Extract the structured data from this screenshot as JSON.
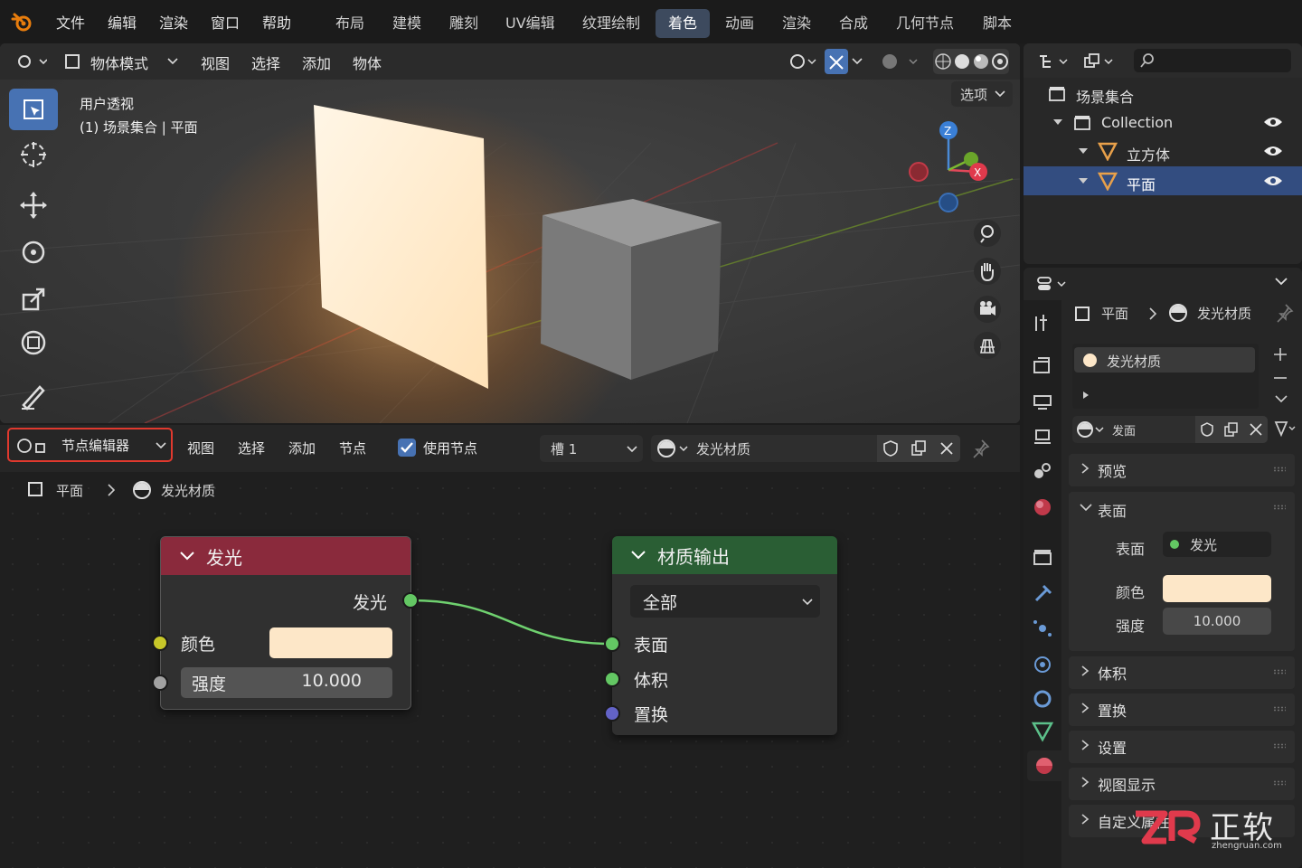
{
  "menu": [
    "文件",
    "编辑",
    "渲染",
    "窗口",
    "帮助"
  ],
  "workspaces": [
    "布局",
    "建模",
    "雕刻",
    "UV编辑",
    "纹理绘制",
    "着色",
    "动画",
    "渲染",
    "合成",
    "几何节点",
    "脚本"
  ],
  "active_workspace": "着色",
  "viewport": {
    "mode": "物体模式",
    "menus": [
      "视图",
      "选择",
      "添加",
      "物体"
    ],
    "options_label": "选项",
    "view_name": "用户透视",
    "context": "(1) 场景集合 | 平面",
    "gizmo": {
      "z": "Z",
      "x": "X"
    }
  },
  "node_editor": {
    "editor_type": "节点编辑器",
    "menus": [
      "视图",
      "选择",
      "添加",
      "节点"
    ],
    "use_nodes_label": "使用节点",
    "use_nodes_checked": true,
    "slot": "槽 1",
    "material": "发光材质",
    "breadcrumb": [
      "平面",
      "发光材质"
    ],
    "emission_node": {
      "title": "发光",
      "output_label": "发光",
      "color_label": "颜色",
      "color_value": "#fde7c8",
      "strength_label": "强度",
      "strength_value": "10.000"
    },
    "output_node": {
      "title": "材质输出",
      "target": "全部",
      "inputs": [
        "表面",
        "体积",
        "置换"
      ]
    }
  },
  "outliner": {
    "root": "场景集合",
    "collection": "Collection",
    "items": [
      "立方体",
      "平面"
    ],
    "selected": "平面"
  },
  "properties": {
    "breadcrumb": [
      "平面",
      "发光材质"
    ],
    "slot_material": "发光材质",
    "data_block": "发面",
    "panels": [
      "预览",
      "表面",
      "体积",
      "置换",
      "设置",
      "视图显示",
      "自定义属性"
    ],
    "surface": {
      "surface_label": "表面",
      "surface_value": "发光",
      "color_label": "颜色",
      "color_value": "#fde7c8",
      "strength_label": "强度",
      "strength_value": "10.000"
    }
  },
  "watermark": {
    "text": "正软",
    "url": "zhengruan.com"
  },
  "colors": {
    "accent": "#4772b3",
    "emission_header": "#8a2a3c",
    "output_header": "#2a5e34",
    "socket_green": "#63c763",
    "socket_yellow": "#c7c729",
    "socket_grey": "#a1a1a1",
    "socket_blue": "#6363c7"
  }
}
